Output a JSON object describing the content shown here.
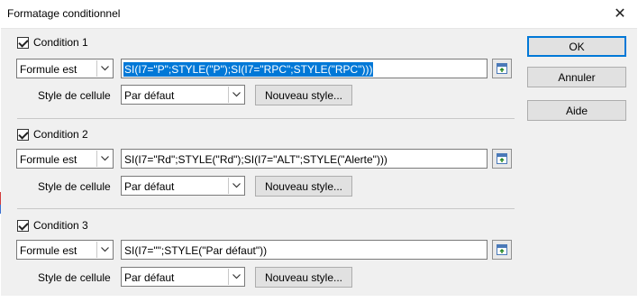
{
  "window": {
    "title": "Formatage conditionnel"
  },
  "conditions": [
    {
      "label": "Condition 1",
      "type": "Formule est",
      "formula": "SI(I7=\"P\";STYLE(\"P\");SI(I7=\"RPC\";STYLE(\"RPC\")))",
      "formula_selected": true,
      "style_label": "Style de cellule",
      "style_value": "Par défaut",
      "new_style_label": "Nouveau style..."
    },
    {
      "label": "Condition 2",
      "type": "Formule est",
      "formula": "SI(I7=\"Rd\";STYLE(\"Rd\");SI(I7=\"ALT\";STYLE(\"Alerte\")))",
      "formula_selected": false,
      "style_label": "Style de cellule",
      "style_value": "Par défaut",
      "new_style_label": "Nouveau style..."
    },
    {
      "label": "Condition 3",
      "type": "Formule est",
      "formula": "SI(I7=\"\";STYLE(\"Par défaut\"))",
      "formula_selected": false,
      "style_label": "Style de cellule",
      "style_value": "Par défaut",
      "new_style_label": "Nouveau style..."
    }
  ],
  "buttons": {
    "ok": "OK",
    "cancel": "Annuler",
    "help": "Aide"
  },
  "icons": {
    "close": "close-icon",
    "dropdown": "chevron-down-icon",
    "shrink": "shrink-icon"
  },
  "colors": {
    "selection": "#0078d7",
    "ok_border": "#0078d7"
  }
}
